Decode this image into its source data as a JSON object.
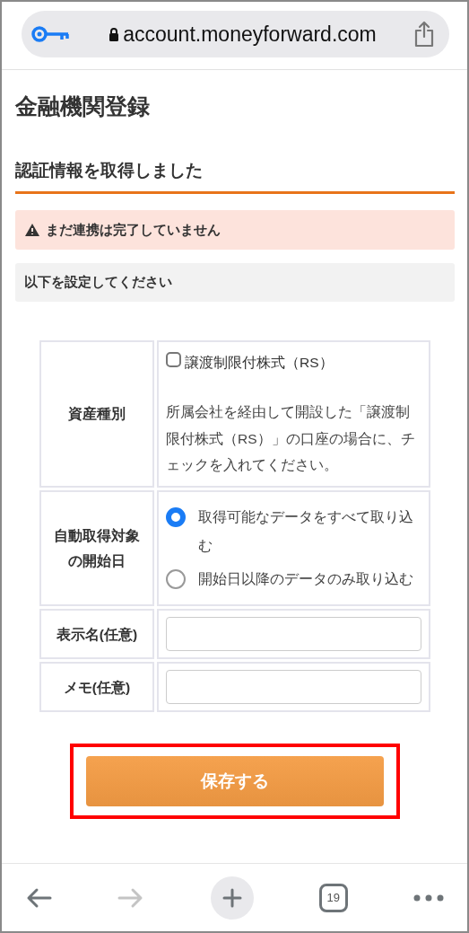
{
  "address_bar": {
    "url": "account.moneyforward.com"
  },
  "page_title": "金融機関登録",
  "section_heading": "認証情報を取得しました",
  "alert": {
    "text": "まだ連携は完了していません"
  },
  "notice": "以下を設定してください",
  "form": {
    "rows": [
      {
        "kind": "checkbox",
        "label": "資産種別",
        "option": {
          "label": "譲渡制限付株式（RS）",
          "checked": false
        },
        "description": "所属会社を経由して開設した「譲渡制限付株式（RS）」の口座の場合に、チェックを入れてください。"
      },
      {
        "kind": "radio",
        "label": "自動取得対象の開始日",
        "options": [
          {
            "label": "取得可能なデータをすべて取り込む",
            "selected": true
          },
          {
            "label": "開始日以降のデータのみ取り込む",
            "selected": false
          }
        ]
      },
      {
        "kind": "text",
        "label": "表示名(任意)"
      },
      {
        "kind": "text",
        "label": "メモ(任意)"
      }
    ]
  },
  "save_button": {
    "label": "保存する",
    "highlighted": true
  },
  "toolbar": {
    "back_disabled": false,
    "forward_disabled": true,
    "tab_count": "19"
  }
}
